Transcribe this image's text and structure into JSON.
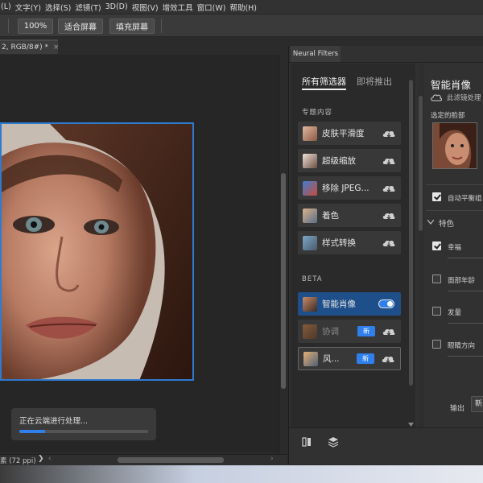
{
  "menubar": {
    "items": [
      "(L)",
      "文字(Y)",
      "选择(S)",
      "滤镜(T)",
      "3D(D)",
      "视图(V)",
      "增效工具",
      "窗口(W)",
      "帮助(H)"
    ]
  },
  "optionsbar": {
    "zoom_value": "100%",
    "fit_screen_label": "适合屏幕",
    "fill_screen_label": "填充屏幕"
  },
  "document": {
    "tab_title": "2, RGB/8#) *",
    "tab_close": "×",
    "status_text": "素 (72 ppi)",
    "status_arrow_right": "❯",
    "status_arrow_left": "‹",
    "status_arrow_end": "›",
    "progress": {
      "label": "正在云端进行处理...",
      "value": 0.2
    }
  },
  "neural_filters": {
    "panel_title": "Neural Filters",
    "tabs": {
      "all": "所有筛选器",
      "coming_soon": "即将推出"
    },
    "featured_section": "专题内容",
    "featured": [
      {
        "label": "皮肤平滑度",
        "icon": "skin-smoothing-icon"
      },
      {
        "label": "超级缩放",
        "icon": "super-zoom-icon"
      },
      {
        "label": "移除 JPEG...",
        "icon": "jpeg-artifacts-icon"
      },
      {
        "label": "着色",
        "icon": "colorize-icon"
      },
      {
        "label": "样式转换",
        "icon": "style-transfer-icon"
      }
    ],
    "beta_section": "BETA",
    "beta": [
      {
        "label": "智能肖像",
        "state": "toggle-on"
      },
      {
        "label": "协调",
        "badge": "新"
      },
      {
        "label": "风...",
        "badge": "新"
      }
    ],
    "detail": {
      "title": "智能肖像",
      "cloud_note": "此滤镜处理",
      "selected_face_label": "选定的脸部",
      "auto_balance_label": "自动平衡组",
      "features_label": "特色",
      "features": [
        {
          "label": "幸福",
          "checked": true
        },
        {
          "label": "面部年龄",
          "checked": false
        },
        {
          "label": "发量",
          "checked": false
        },
        {
          "label": "眼睛方向",
          "checked": false
        }
      ],
      "output_label": "输出",
      "output_value": "新"
    }
  },
  "colors": {
    "accent": "#2f80ed",
    "selection_border": "#2e7bd1",
    "panel_bg": "#313131"
  }
}
